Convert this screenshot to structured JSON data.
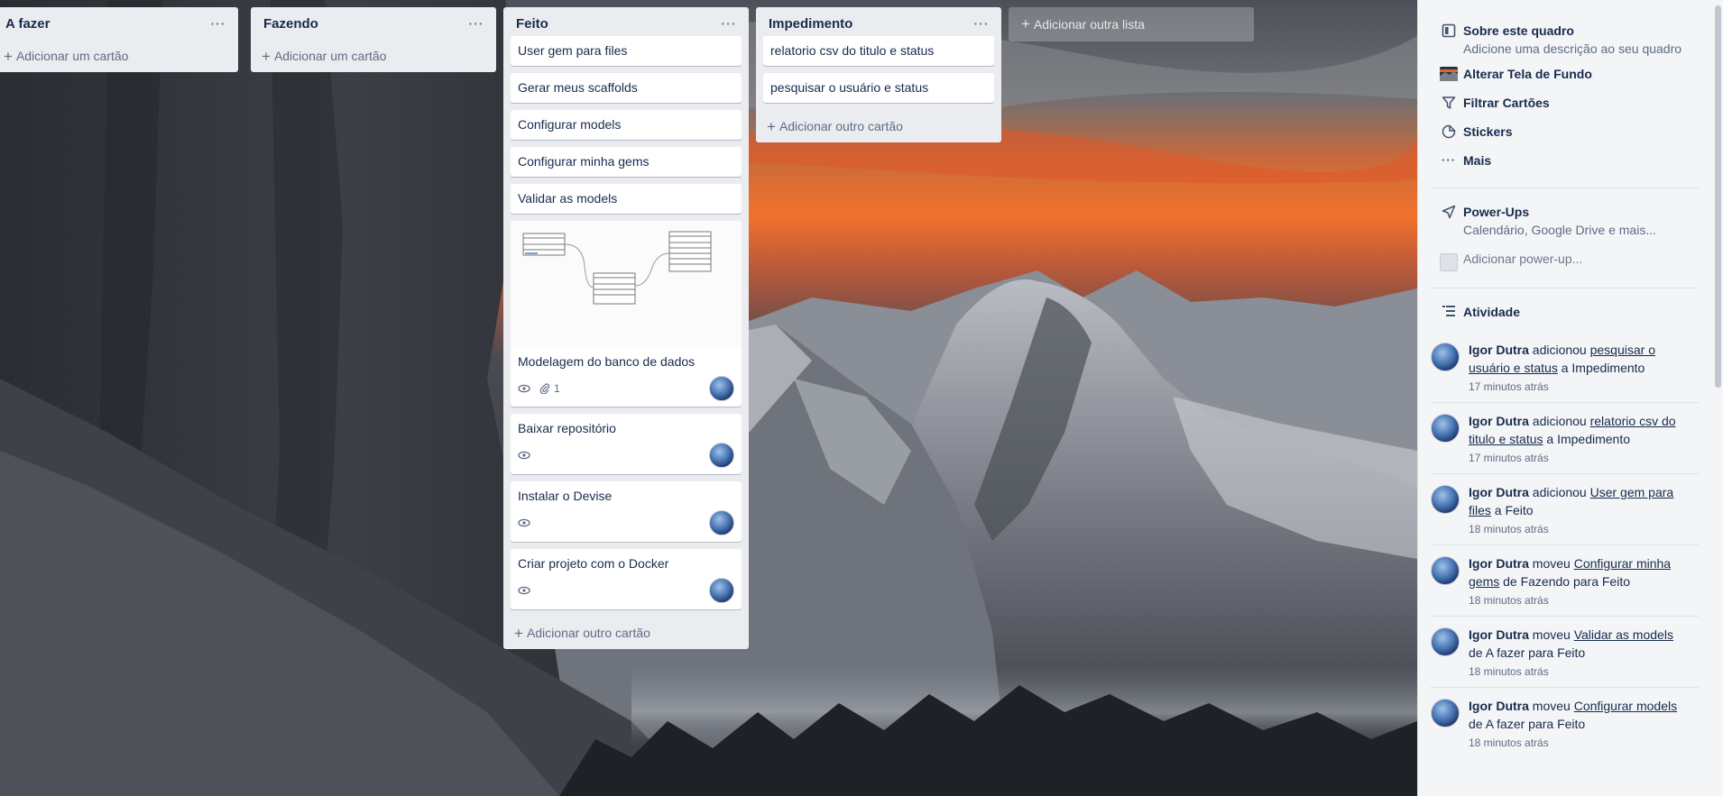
{
  "colors": {
    "list_bg": "#ebecf0",
    "card_bg": "#ffffff",
    "sidebar_bg": "#f4f5f7",
    "text": "#172b4d",
    "muted": "#5e6c84"
  },
  "lists": [
    {
      "title": "A fazer",
      "menu_icon": "ellipsis-icon",
      "add_label": "Adicionar um cartão",
      "cards": []
    },
    {
      "title": "Fazendo",
      "menu_icon": "ellipsis-icon",
      "add_label": "Adicionar um cartão",
      "cards": []
    },
    {
      "title": "Feito",
      "menu_icon": "ellipsis-icon",
      "add_label": "Adicionar outro cartão",
      "cards": [
        {
          "title": "User gem para files"
        },
        {
          "title": "Gerar meus scaffolds"
        },
        {
          "title": "Configurar models"
        },
        {
          "title": "Configurar minha gems"
        },
        {
          "title": "Validar as models"
        },
        {
          "title": "Modelagem do banco de dados",
          "cover": "database-diagram",
          "attachments": "1"
        },
        {
          "title": "Baixar repositório"
        },
        {
          "title": "Instalar o Devise"
        },
        {
          "title": "Criar projeto com o Docker"
        }
      ]
    },
    {
      "title": "Impedimento",
      "menu_icon": "ellipsis-icon",
      "add_label": "Adicionar outro cartão",
      "cards": [
        {
          "title": "relatorio csv do titulo e status"
        },
        {
          "title": "pesquisar o usuário e status"
        }
      ]
    }
  ],
  "add_list_label": "Adicionar outra lista",
  "sidebar": {
    "about": {
      "title": "Sobre este quadro",
      "subtitle": "Adicione uma descrição ao seu quadro"
    },
    "change_background": "Alterar Tela de Fundo",
    "filter_cards": "Filtrar Cartões",
    "stickers": "Stickers",
    "more": "Mais",
    "powerups": {
      "title": "Power-Ups",
      "subtitle": "Calendário, Google Drive e mais..."
    },
    "add_powerup": "Adicionar power-up...",
    "activity_title": "Atividade",
    "activity": [
      {
        "user": "Igor Dutra",
        "verb": "adicionou",
        "card": "pesquisar o usuário e status",
        "rest": "a Impedimento",
        "time": "17 minutos atrás"
      },
      {
        "user": "Igor Dutra",
        "verb": "adicionou",
        "card": "relatorio csv do titulo e status",
        "rest": "a Impedimento",
        "time": "17 minutos atrás"
      },
      {
        "user": "Igor Dutra",
        "verb": "adicionou",
        "card": "User gem para files",
        "rest": "a Feito",
        "time": "18 minutos atrás"
      },
      {
        "user": "Igor Dutra",
        "verb": "moveu",
        "card": "Configurar minha gems",
        "rest": "de Fazendo para Feito",
        "time": "18 minutos atrás"
      },
      {
        "user": "Igor Dutra",
        "verb": "moveu",
        "card": "Validar as models",
        "rest": "de A fazer para Feito",
        "time": "18 minutos atrás"
      },
      {
        "user": "Igor Dutra",
        "verb": "moveu",
        "card": "Configurar models",
        "rest": "de A fazer para Feito",
        "time": "18 minutos atrás"
      }
    ]
  }
}
